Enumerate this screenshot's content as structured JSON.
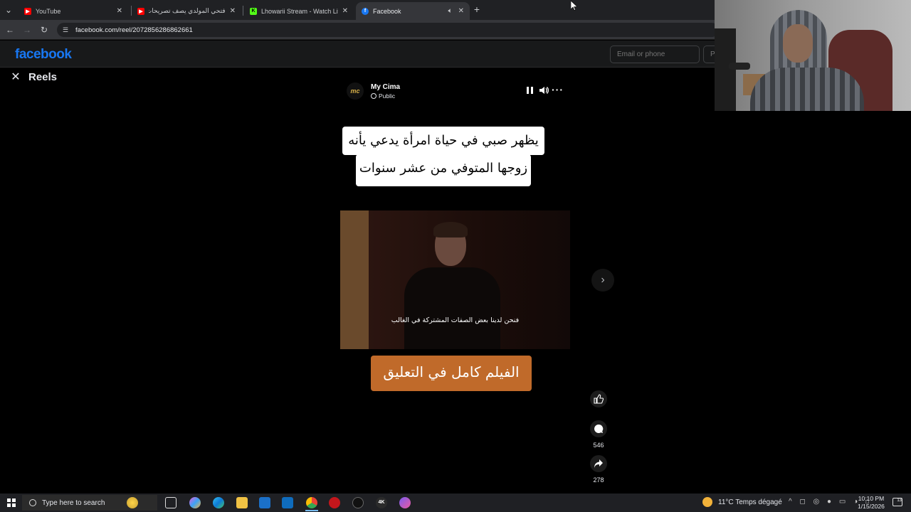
{
  "browser": {
    "tabs": [
      {
        "label": "YouTube",
        "favicon": "youtube-icon",
        "color": "#ff0000"
      },
      {
        "label": "فتحي المولدي يصف تصريحات حـ",
        "favicon": "youtube-icon",
        "color": "#ff0000"
      },
      {
        "label": "Lhowarii Stream - Watch Live o",
        "favicon": "kick-icon",
        "color": "#53fc18"
      },
      {
        "label": "Facebook",
        "favicon": "facebook-icon",
        "color": "#1877f2"
      }
    ],
    "url": "facebook.com/reel/2072856286862661"
  },
  "fb_header": {
    "logo": "facebook",
    "email_placeholder": "Email or phone",
    "password_placeholder": "P"
  },
  "reels": {
    "title": "Reels",
    "channel_name": "My Cima",
    "avatar_text": "mc",
    "visibility": "Public",
    "caption_line1": "يظهر صبي في حياة امرأة يدعي يأنه",
    "caption_line2": "زوجها المتوفي من عشر سنوات",
    "video_subtitle": "فنحن لدينا بعض الصفات المشتركة في الغالب",
    "banner": "الفيلم كامل في التعليق",
    "comments_count": "546",
    "shares_count": "278"
  },
  "taskbar": {
    "search_placeholder": "Type here to search",
    "weather": "11°C  Temps dégagé",
    "time": "10:10 PM",
    "date": "1/15/2026",
    "notifications": "13"
  },
  "colors": {
    "facebook_blue": "#1877f2",
    "banner": "#c06a2a"
  }
}
